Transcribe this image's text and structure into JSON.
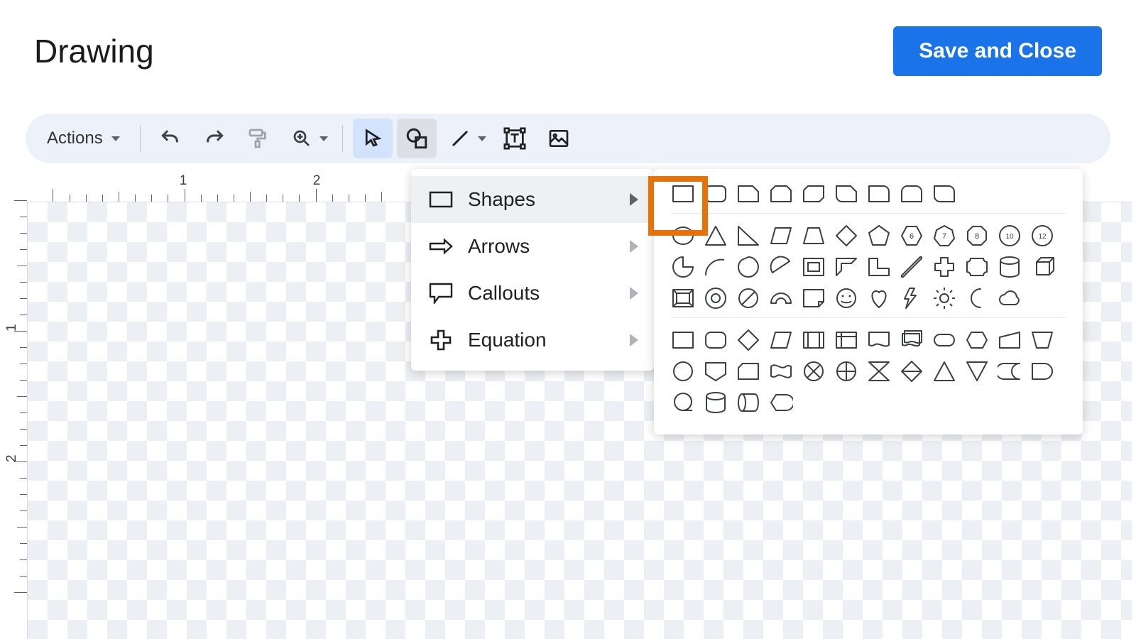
{
  "header": {
    "title": "Drawing",
    "save_label": "Save and Close"
  },
  "toolbar": {
    "actions_label": "Actions"
  },
  "submenu": {
    "items": [
      {
        "label": "Shapes"
      },
      {
        "label": "Arrows"
      },
      {
        "label": "Callouts"
      },
      {
        "label": "Equation"
      }
    ]
  },
  "ruler": {
    "h": [
      "1",
      "2"
    ],
    "v": [
      "1",
      "2"
    ]
  },
  "palette": {
    "row1": [
      "rectangle",
      "rounded-rectangle",
      "snip-single-corner-rectangle",
      "snip-same-side-corner-rectangle",
      "snip-diagonal-corner-rectangle",
      "snip-and-round-single-corner-rectangle",
      "round-single-corner-rectangle",
      "round-same-side-corner-rectangle",
      "round-diagonal-corner-rectangle"
    ],
    "row2a": [
      "ellipse",
      "triangle",
      "right-triangle",
      "parallelogram",
      "trapezoid",
      "diamond",
      "pentagon",
      "hexagon",
      "heptagon",
      "octagon",
      "decagon",
      "dodecagon"
    ],
    "row2b": [
      "pie",
      "arc",
      "teardrop",
      "chord",
      "frame",
      "half-frame",
      "l-shape",
      "diagonal-stripe",
      "cross",
      "plaque",
      "can",
      "cube"
    ],
    "row2c": [
      "bevel",
      "donut",
      "no-symbol",
      "block-arc",
      "folded-corner",
      "smiley-face",
      "heart",
      "lightning-bolt",
      "sun",
      "moon",
      "cloud"
    ],
    "row3a": [
      "flowchart-process",
      "flowchart-alternate-process",
      "flowchart-decision",
      "flowchart-data",
      "flowchart-predefined-process",
      "flowchart-internal-storage",
      "flowchart-document",
      "flowchart-multidocument",
      "flowchart-terminator",
      "flowchart-preparation",
      "flowchart-manual-input",
      "flowchart-manual-operation"
    ],
    "row3b": [
      "flowchart-connector",
      "flowchart-offpage-connector",
      "flowchart-card",
      "flowchart-punched-tape",
      "flowchart-summing-junction",
      "flowchart-or",
      "flowchart-collate",
      "flowchart-sort",
      "flowchart-extract",
      "flowchart-merge",
      "flowchart-stored-data",
      "flowchart-delay"
    ],
    "row3c": [
      "flowchart-sequential-access-storage",
      "flowchart-magnetic-disk",
      "flowchart-direct-access-storage",
      "flowchart-display"
    ]
  }
}
